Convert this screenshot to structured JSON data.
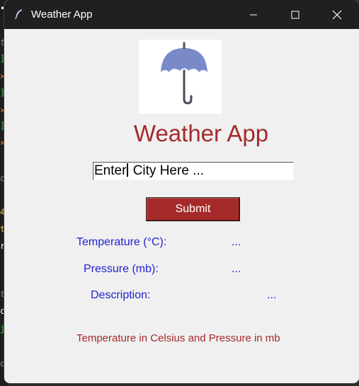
{
  "window": {
    "title": "Weather App"
  },
  "app": {
    "heading": "Weather App",
    "logo_icon": "umbrella-icon",
    "city_input": {
      "value_before_caret": "Enter",
      "value_after_caret": " City Here ..."
    },
    "submit_label": "Submit",
    "fields": {
      "temperature_label": "Temperature (°C):",
      "temperature_value": "...",
      "pressure_label": "Pressure (mb):",
      "pressure_value": "...",
      "description_label": "Description:",
      "description_value": "..."
    },
    "footer_note": "Temperature in Celsius and Pressure in mb"
  },
  "colors": {
    "accent": "#a52a2a",
    "label_blue": "#1f1fd1",
    "titlebar": "#202020",
    "window_bg": "#f0f0f0"
  }
}
